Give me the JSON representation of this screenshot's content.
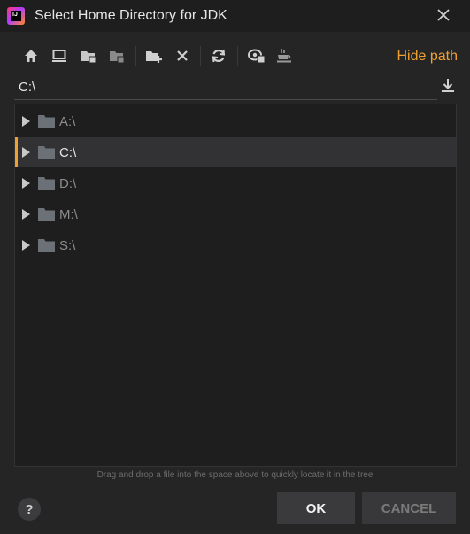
{
  "window": {
    "title": "Select Home Directory for JDK",
    "app_icon_letters": "IJ"
  },
  "toolbar": {
    "buttons": [
      "home-icon",
      "desktop-icon",
      "project-folder-icon",
      "module-folder-icon",
      "new-folder-icon",
      "delete-icon",
      "refresh-icon",
      "show-hidden-icon",
      "jdk-icon"
    ],
    "hide_path_label": "Hide path"
  },
  "path": {
    "value": "C:\\"
  },
  "tree": {
    "items": [
      {
        "label": "A:\\",
        "selected": false
      },
      {
        "label": "C:\\",
        "selected": true
      },
      {
        "label": "D:\\",
        "selected": false
      },
      {
        "label": "M:\\",
        "selected": false
      },
      {
        "label": "S:\\",
        "selected": false
      }
    ]
  },
  "hint": "Drag and drop a file into the space above to quickly locate it in the tree",
  "footer": {
    "help_label": "?",
    "ok_label": "OK",
    "cancel_label": "CANCEL"
  },
  "colors": {
    "accent": "#f0a030",
    "background": "#252526",
    "tree_background": "#1e1e1f"
  }
}
